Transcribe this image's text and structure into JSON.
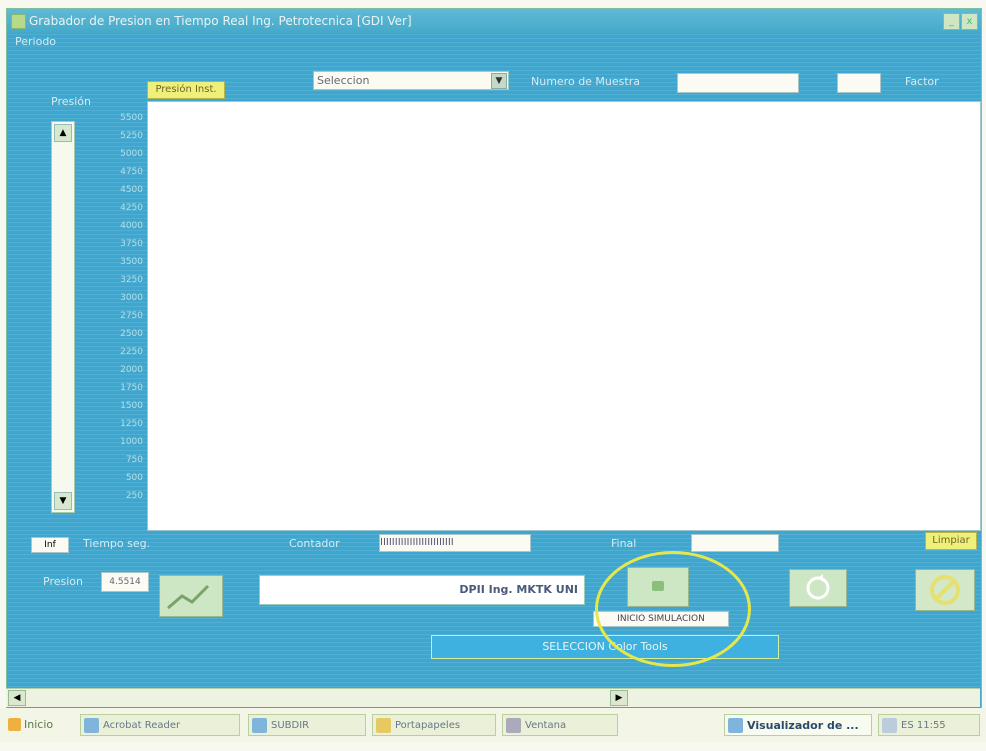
{
  "window": {
    "title": "Grabador de Presion en Tiempo Real Ing. Petrotecnica [GDI Ver]",
    "menu": "Periodo",
    "minimize": "_",
    "close": "x"
  },
  "toolbar": {
    "left_button": "Presión Inst.",
    "select_value": "Seleccion",
    "number_label": "Numero de Muestra",
    "right_label": "Factor"
  },
  "side": {
    "label": "Presión",
    "ticks": [
      "5500",
      "5250",
      "5000",
      "4750",
      "4500",
      "4250",
      "4000",
      "3750",
      "3500",
      "3250",
      "3000",
      "2750",
      "2500",
      "2250",
      "2000",
      "1750",
      "1500",
      "1250",
      "1000",
      "750",
      "500",
      "250"
    ]
  },
  "bottom_row": {
    "left_small": "Inf",
    "time_label": "Tiempo seg.",
    "counter_label": "Contador",
    "counter_value": "IIIIIIIIIIIIIIIIIIIIIIIII",
    "end_label": "Final",
    "right_button": "Limpiar"
  },
  "control_row": {
    "label": "Presion",
    "value_button": "4.5514",
    "status_text": "DPII Ing. MKTK UNI",
    "tooltip": "INICIO SIMULACION",
    "big_button": "SELECCION Color Tools"
  },
  "taskbar": {
    "start": "Inicio",
    "items": [
      "Acrobat Reader",
      "SUBDIR",
      "Portapapeles",
      "Ventana",
      "Visualizador de ...",
      "ES 11:55"
    ]
  }
}
